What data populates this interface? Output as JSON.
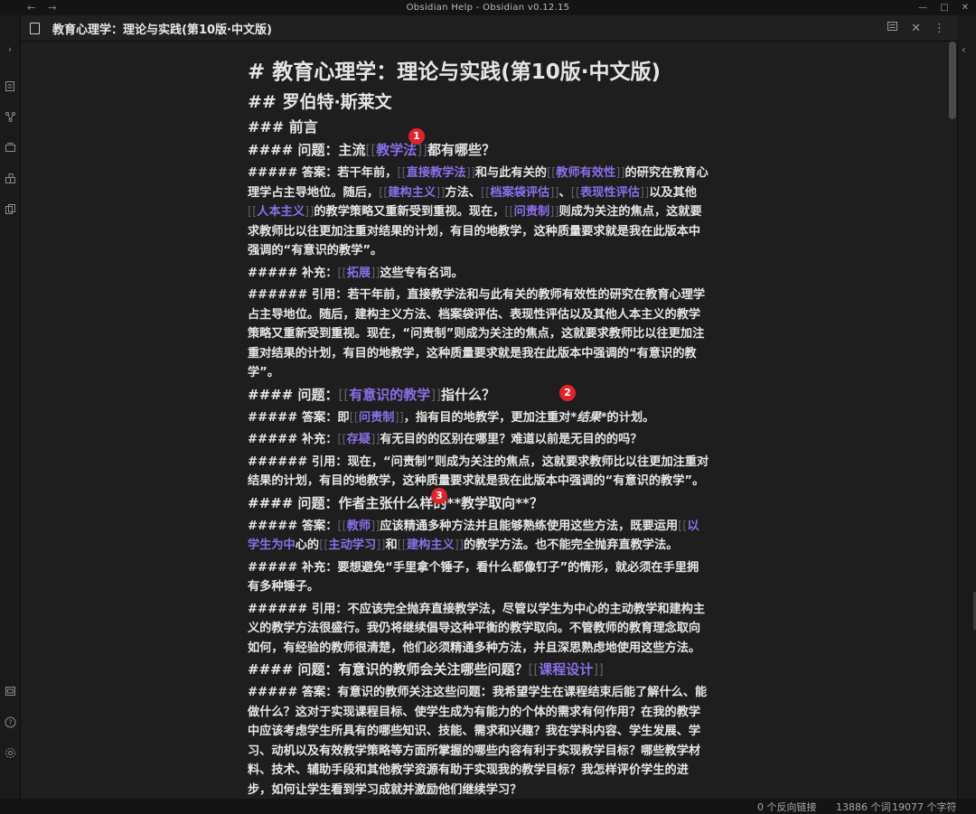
{
  "window": {
    "title": "Obsidian Help - Obsidian v0.12.15",
    "back_glyph": "←",
    "forward_glyph": "→"
  },
  "tab": {
    "title": "教育心理学：理论与实践(第10版·中文版)"
  },
  "doc": {
    "h1": "# 教育心理学：理论与实践(第10版·中文版)",
    "h2": "## 罗伯特·斯莱文",
    "h3": "### 前言",
    "q1": {
      "p1": "#### 问题：主流",
      "l1": "教学法",
      "p2": "都有哪些？"
    },
    "a1": {
      "p1": "##### 答案：若干年前，",
      "l1": "直接教学法",
      "p2": "和与此有关的",
      "l2": "教师有效性",
      "p3": "的研究在教育心理学占主导地位。随后，",
      "l3": "建构主义",
      "p4": "方法、",
      "l4": "档案袋评估",
      "p5": "、",
      "l5": "表现性评估",
      "p6": "以及其他",
      "l6": "人本主义",
      "p7": "的教学策略又重新受到重视。现在，",
      "l7": "问责制",
      "p8": "则成为关注的焦点，这就要求教师比以往更加注重对结果的计划，有目的地教学，这种质量要求就是我在此版本中强调的“有意识的教学”。"
    },
    "s1": {
      "p1": "##### 补充：",
      "l1": "拓展",
      "p2": "这些专有名词。"
    },
    "c1": "###### 引用：若干年前，直接教学法和与此有关的教师有效性的研究在教育心理学占主导地位。随后，建构主义方法、档案袋评估、表现性评估以及其他人本主义的教学策略又重新受到重视。现在，“问责制”则成为关注的焦点，这就要求教师比以往更加注重对结果的计划，有目的地教学，这种质量要求就是我在此版本中强调的“有意识的教学”。",
    "q2": {
      "p1": "#### 问题：",
      "l1": "有意识的教学",
      "p2": "指什么？"
    },
    "a2": {
      "p1": "##### 答案：即",
      "l1": "问责制",
      "p2": "，指有目的地教学，更加注重对",
      "em": "*结果*",
      "p3": "的计划。"
    },
    "s2": {
      "p1": "##### 补充：",
      "l1": "存疑",
      "p2": "有无目的的区别在哪里？难道以前是无目的的吗？"
    },
    "c2": "###### 引用：现在，“问责制”则成为关注的焦点，这就要求教师比以往更加注重对结果的计划，有目的地教学，这种质量要求就是我在此版本中强调的“有意识的教学”。",
    "q3": "#### 问题：作者主张什么样的**教学取向**？",
    "a3": {
      "p1": "##### 答案：",
      "l1": "教师",
      "p2": "应该精通多种方法并且能够熟练使用这些方法，既要运用",
      "l2": "以学生为中",
      "p3": "心的",
      "l3": "主动学习",
      "p4": "和",
      "l4": "建构主义",
      "p5": "的教学方法。也不能完全抛弃直教学法。"
    },
    "s3": "##### 补充：要想避免“手里拿个锤子，看什么都像钉子”的情形，就必须在手里拥有多种锤子。",
    "c3": "###### 引用：不应该完全抛弃直接教学法，尽管以学生为中心的主动教学和建构主义的教学方法很盛行。我仍将继续倡导这种平衡的教学取向。不管教师的教育理念取向如何，有经验的教师很清楚，他们必须精通多种方法，并且深思熟虑地使用这些方法。",
    "q4": {
      "p1": "#### 问题：有意识的教师会关注哪些问题？",
      "l1": "课程设计"
    },
    "a4": "##### 答案：有意识的教师关注这些问题：我希望学生在课程结束后能了解什么、能做什么？这对于实现课程目标、使学生成为有能力的个体的需求有何作用？在我的教学中应该考虑学生所具有的哪些知识、技能、需求和兴趣？我在学科内容、学生发展、学习、动机以及有效教学策略等方面所掌握的哪些内容有利于实现教学目标？哪些教学材料、技术、辅助手段和其他教学资源有助于实现我的教学目标？我怎样评价学生的进步，如何让学生看到学习成就并激励他们继续学习？"
  },
  "markers": [
    "1",
    "2",
    "3"
  ],
  "status": {
    "backlinks": "0 个反向链接",
    "words": "13886 个词",
    "chars": "19077 个字符"
  },
  "colors": {
    "link": "#8a6fe8",
    "marker": "#e0242b",
    "bg": "#1e1e1e"
  }
}
